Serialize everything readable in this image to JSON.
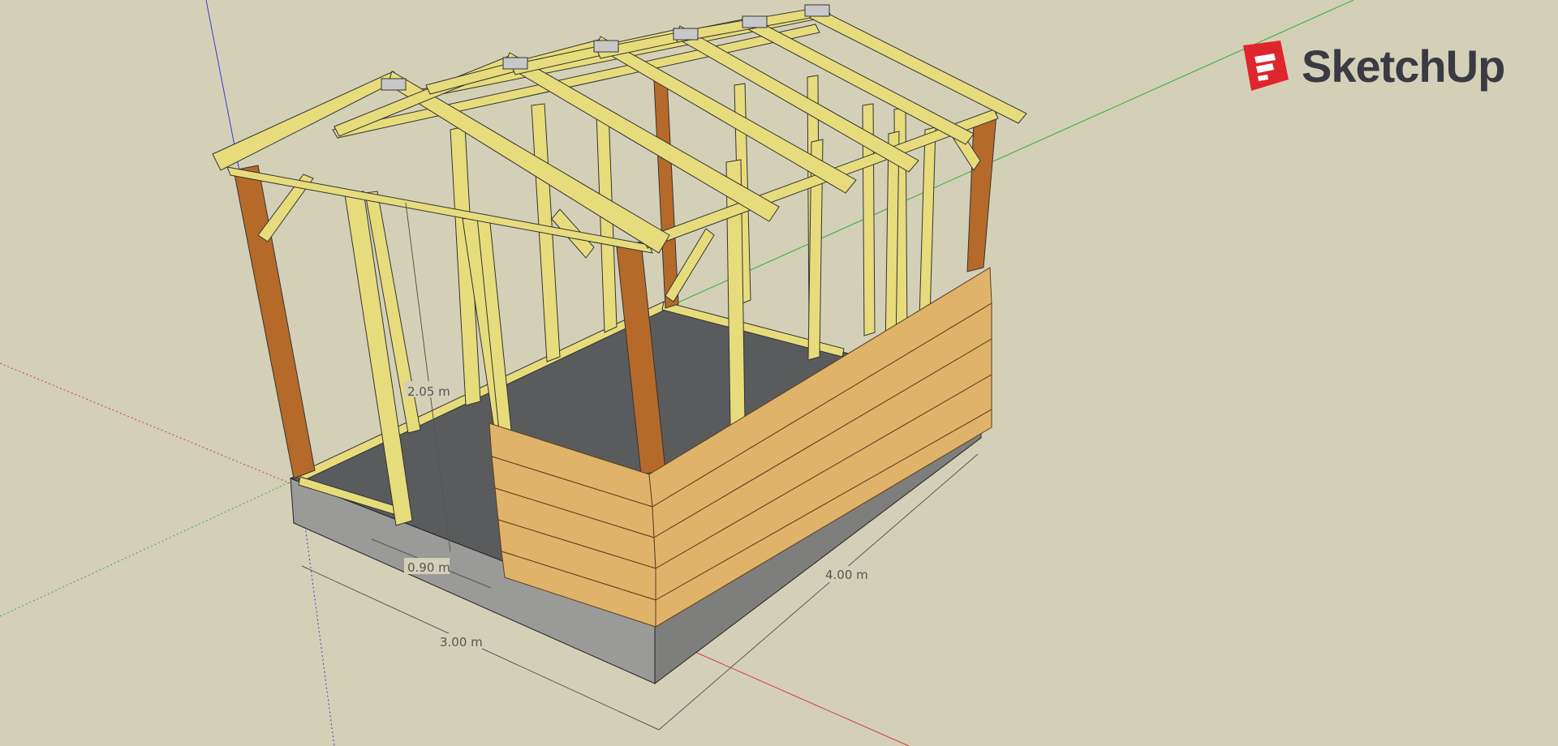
{
  "app": {
    "name": "SketchUp"
  },
  "model": {
    "subject": "timber frame shed"
  },
  "dimensions": {
    "height": "2.05 m",
    "door_width": "0.90 m",
    "width": "3.00 m",
    "length": "4.00 m"
  },
  "colors": {
    "background": "#d4d0b7",
    "timber": "#e6dc7c",
    "timber_dark": "#b9a94c",
    "post_dark": "#b56a2a",
    "cladding": "#e0b36a",
    "slab_top": "#5a5b5c",
    "slab_side": "#9a9a99",
    "axis_red": "#d43a3a",
    "axis_green": "#33b033",
    "axis_blue": "#3a3ad4",
    "logo_red": "#e0262d",
    "logo_text": "#3a3a44"
  }
}
